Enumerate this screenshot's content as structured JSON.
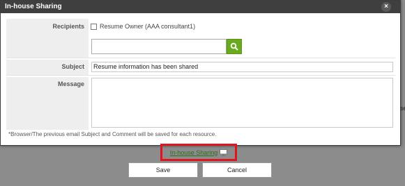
{
  "dialog": {
    "title": "In-house Sharing",
    "close_symbol": "×"
  },
  "form": {
    "recipients_label": "Recipients",
    "resume_owner_label": "Resume Owner (AAA consultant1)",
    "resume_owner_checked": false,
    "search_value": "",
    "subject_label": "Subject",
    "subject_value": "Resume information has been shared",
    "message_label": "Message",
    "message_value": ""
  },
  "note": "*Browser/The previous email Subject and Comment will be saved for each resource.",
  "footer": {
    "share_link": "In-house Sharing",
    "save_label": "Save",
    "cancel_label": "Cancel"
  },
  "background": {
    "right_edge_text": "se"
  },
  "colors": {
    "titlebar": "#3f3f3f",
    "search_button": "#6aaa1e",
    "highlight_border": "#e0141e",
    "link": "#2c6e1a"
  },
  "icons": {
    "search": "magnifier-icon",
    "share": "monitor-icon",
    "close": "close-icon"
  }
}
